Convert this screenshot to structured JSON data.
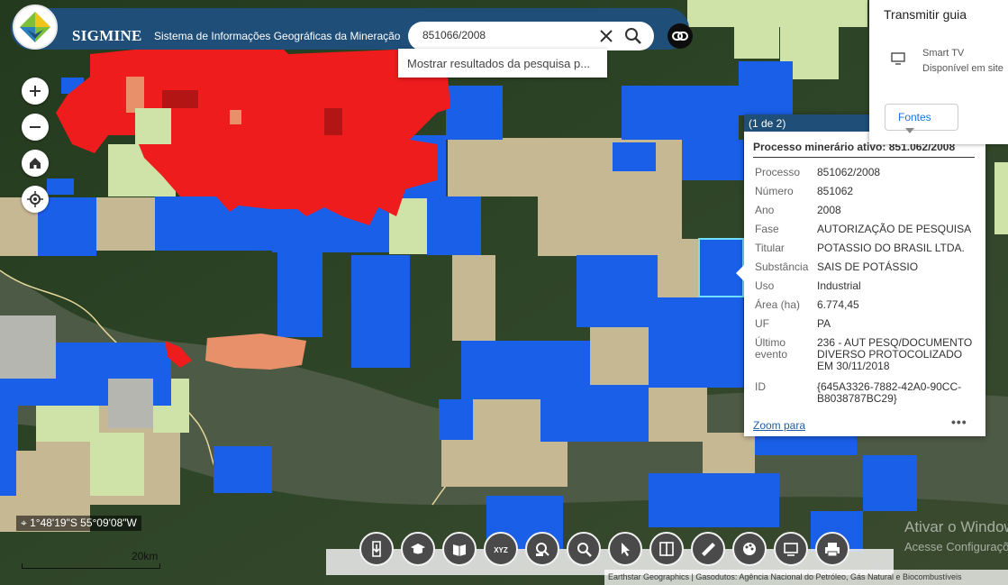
{
  "app": {
    "brand": "SIGMINE",
    "subtitle": "Sistema de Informações Geográficas da Mineração"
  },
  "search": {
    "value": "851066/2008",
    "suggestion": "Mostrar resultados da pesquisa p..."
  },
  "colors": {
    "header": "#1f4e79",
    "active_process": "#ee1c1c",
    "authorization": "#1a5fe8",
    "availability": "#c7b894",
    "concession": "#cfe3a8",
    "other": "#e8906a"
  },
  "controls": {
    "zoom_in": "plus-icon",
    "zoom_out": "minus-icon",
    "home": "home-icon",
    "locate": "locate-icon"
  },
  "popup": {
    "pager": "(1 de 2)",
    "title": "Processo minerário ativo: 851.062/2008",
    "rows": [
      {
        "key": "Processo",
        "value": "851062/2008"
      },
      {
        "key": "Número",
        "value": "851062"
      },
      {
        "key": "Ano",
        "value": "2008"
      },
      {
        "key": "Fase",
        "value": "AUTORIZAÇÃO DE PESQUISA"
      },
      {
        "key": "Titular",
        "value": "POTASSIO DO BRASIL LTDA."
      },
      {
        "key": "Substância",
        "value": "SAIS DE POTÁSSIO"
      },
      {
        "key": "Uso",
        "value": "Industrial"
      },
      {
        "key": "Área (ha)",
        "value": "6.774,45"
      },
      {
        "key": "UF",
        "value": "PA"
      },
      {
        "key": "Último evento",
        "value": "236 - AUT PESQ/DOCUMENTO DIVERSO PROTOCOLIZADO EM 30/11/2018"
      },
      {
        "key": "ID",
        "value": "{645A3326-7882-42A0-90CC-B8038787BC29}"
      }
    ],
    "zoom_link": "Zoom para",
    "more": "•••"
  },
  "cast": {
    "title": "Transmitir guia",
    "device": "Smart TV",
    "status": "Disponível em site",
    "sources_button": "Fontes"
  },
  "toolbar": {
    "tools": [
      "download-icon",
      "graduation-icon",
      "book-icon",
      "xyz-icon",
      "search-layer-icon",
      "search-icon",
      "select-icon",
      "split-icon",
      "ruler-icon",
      "palette-icon",
      "layers-icon",
      "print-icon"
    ],
    "xyz_label": "XYZ"
  },
  "map": {
    "coordinates": "1°48'19\"S 55°09'08\"W",
    "scale_label": "20km",
    "attribution": "Earthstar Geographics | Gasodutos: Agência Nacional do Petróleo, Gás Natural e Biocombustíveis",
    "watermark_title": "Ativar o Windows",
    "watermark_text": "Acesse Configurações"
  }
}
